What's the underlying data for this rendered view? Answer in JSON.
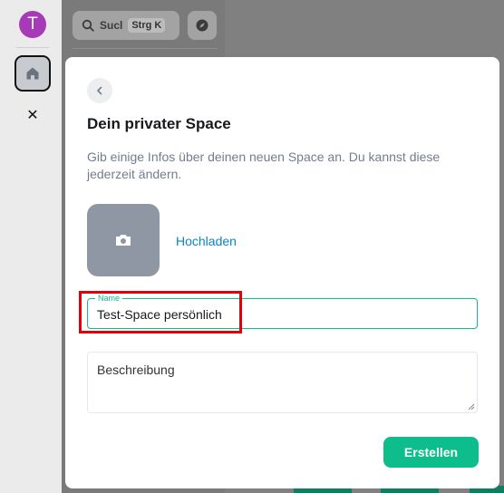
{
  "rail": {
    "avatar_letter": "T",
    "avatar_color": "#a73ab6",
    "home_icon": "home-icon",
    "close_glyph": "✕"
  },
  "sidebar": {
    "search_text": "Sucl",
    "search_shortcut": "Strg K",
    "explore_icon": "compass-icon"
  },
  "dialog": {
    "title": "Dein privater Space",
    "subtitle": "Gib einige Infos über deinen neuen Space an. Du kannst diese jederzeit ändern.",
    "upload_label": "Hochladen",
    "name_label": "Name",
    "name_value": "Test-Space persönlich",
    "description_placeholder": "Beschreibung",
    "submit_label": "Erstellen",
    "accent_color": "#0dbd8b",
    "link_color": "#0a85c2"
  }
}
